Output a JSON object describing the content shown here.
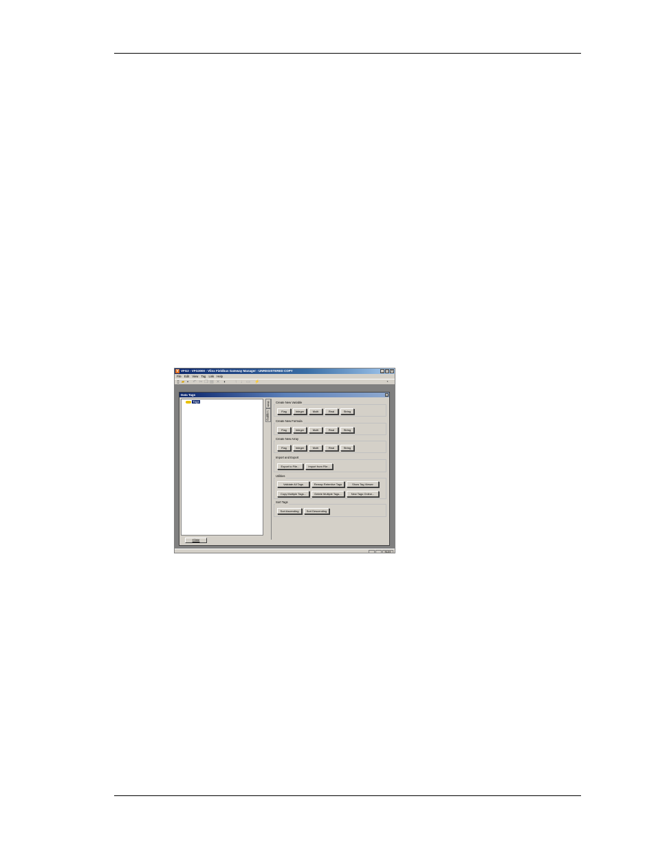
{
  "window": {
    "app_icon": "V",
    "title": "VFG2 - VFG3000 - Vlinx Fieldbus Gateway Manager - UNREGISTERED COPY",
    "min_icon": "_",
    "max_icon": "□",
    "close_icon": "×"
  },
  "menu": [
    "File",
    "Edit",
    "View",
    "Tag",
    "Link",
    "Help"
  ],
  "child": {
    "title": "Data Tags",
    "close_icon": "×",
    "tree_root": "Tags",
    "tabs": [
      "Main",
      "Logging"
    ],
    "close_button": "Close"
  },
  "groups": [
    {
      "label": "Create New Variable",
      "buttons": [
        "Flag",
        "Integer",
        "Multi",
        "Real",
        "String"
      ]
    },
    {
      "label": "Create New Formula",
      "buttons": [
        "Flag",
        "Integer",
        "Multi",
        "Real",
        "String"
      ]
    },
    {
      "label": "Create New Array",
      "buttons": [
        "Flag",
        "Integer",
        "Multi",
        "Real",
        "String"
      ]
    },
    {
      "label": "Import and Export",
      "buttons": [
        "Export to File...",
        "Import from File..."
      ]
    },
    {
      "label": "Utilities",
      "buttons": [
        "Validate All Tags",
        "Remap Retentive Tags",
        "Show Tag Viewer",
        "Copy Multiple Tags...",
        "Delete Multiple Tags...",
        "New Tags Online..."
      ]
    },
    {
      "label": "Sort Tags",
      "buttons": [
        "Sort Ascending",
        "Sort Descending"
      ]
    }
  ],
  "status": {
    "num": "NUM"
  }
}
